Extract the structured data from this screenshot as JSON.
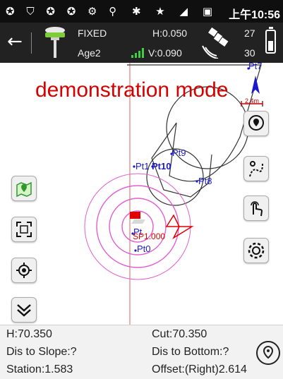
{
  "status_bar": {
    "left_icons": "✪ ⛉ ✪ ✪ ⚙ ⚲",
    "right_icons": "✱ ★ ◢ ▣",
    "time": "上午10:56"
  },
  "toolbar": {
    "fix_status": "FIXED",
    "age": "Age2",
    "h_precision": "H:0.050",
    "v_precision": "V:0.090",
    "satellites_used": "27",
    "satellites_visible": "30"
  },
  "map": {
    "mode_banner": "demonstration mode",
    "point_labels": [
      "Pt7",
      "Pt9",
      "Pt1",
      "Pt10",
      "Pt8",
      "Pt",
      "Pt0",
      "SP1.000"
    ],
    "scale_label": "2.4m",
    "icons": [
      "map-layer-icon",
      "fit-extent-icon",
      "locate-icon",
      "collapse-icon",
      "stakeout-point-icon",
      "route-icon",
      "touch-select-icon",
      "settings-gear-icon"
    ]
  },
  "bottom_panel": {
    "h_value": "H:70.350",
    "cut_value": "Cut:70.350",
    "dis_to_slope": "Dis to Slope:?",
    "dis_to_bottom": "Dis to Bottom:?",
    "station": "Station:1.583",
    "offset": "Offset:(Right)2.614"
  },
  "colors": {
    "statusbar_bg": "#0f0f0f",
    "toolbar_bg": "#222222",
    "banner_red": "#d60000",
    "point_blue": "#1a1acc",
    "circle_magenta": "#e060d0",
    "accent_green": "#2e9a2e"
  }
}
